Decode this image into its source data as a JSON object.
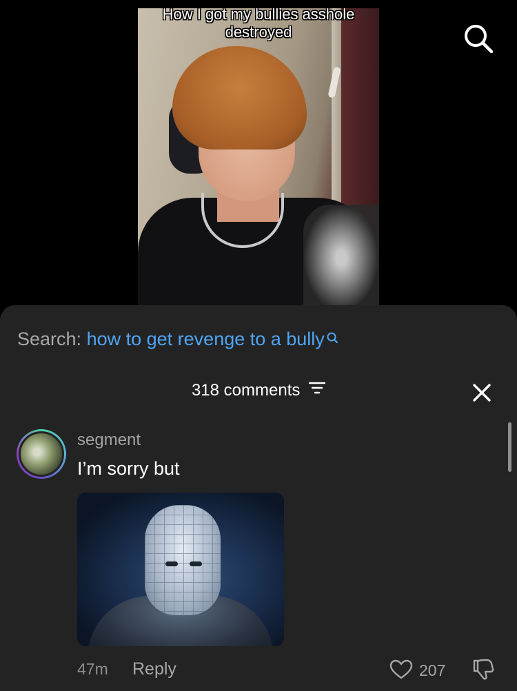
{
  "video": {
    "caption": "How I got my bullies asshole destroyed",
    "icons": {
      "search": "search-icon"
    }
  },
  "sheet": {
    "search_label": "Search:",
    "search_term": "how to get revenge to a bully",
    "comments_count": "318 comments",
    "icons": {
      "filter": "filter-icon",
      "close": "close-icon",
      "search_mini": "search-icon"
    }
  },
  "comment": {
    "username": "segment",
    "text": "I’m sorry but",
    "time": "47m",
    "reply_label": "Reply",
    "like_count": "207",
    "icons": {
      "like": "heart-icon",
      "dislike": "thumbs-down-icon"
    }
  },
  "colors": {
    "sheet_bg": "#232323",
    "search_term": "#4ea5f5",
    "muted_text": "#a6a6a6"
  }
}
